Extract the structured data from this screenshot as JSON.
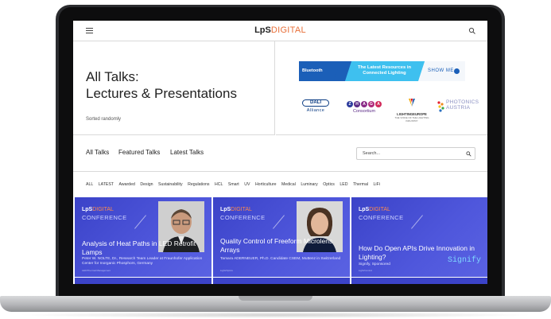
{
  "header": {
    "logo_main": "LpS",
    "logo_suffix": "DIGITAL",
    "menu_icon": "hamburger-icon",
    "search_icon": "search-icon"
  },
  "hero": {
    "title_line1": "All Talks:",
    "title_line2": "Lectures & Presentations",
    "sorted": "Sorted randomly"
  },
  "banner": {
    "brand": "Bluetooth",
    "text": "The Latest Resources in Connected Lighting",
    "cta": "SHOW ME"
  },
  "sponsors": {
    "dali_badge": "DALI",
    "dali_text": "Alliance",
    "zhaga_letters": [
      "Z",
      "H",
      "A",
      "G",
      "A"
    ],
    "zhaga_text": "Consortium",
    "lightingeurope": "LIGHTINGEUROPE",
    "lightingeurope_sub": "THE VOICE OF THE LIGHTING INDUSTRY",
    "photonics_line1": "PHOTONICS",
    "photonics_line2": "AUSTRIA"
  },
  "tabs": {
    "all": "All Talks",
    "featured": "Featured Talks",
    "latest": "Latest Talks",
    "search_placeholder": "Search..."
  },
  "categories": [
    "ALL",
    "LATEST",
    "Awarded",
    "Design",
    "Sustainability",
    "Regulations",
    "HCL",
    "Smart",
    "UV",
    "Horticulture",
    "Medical",
    "Luminary",
    "Optics",
    "LED",
    "Thermal",
    "LiFi"
  ],
  "cards": [
    {
      "conf_main": "LpS",
      "conf_suffix": "DIGITAL",
      "conf_label": "CONFERENCE",
      "title": "Analysis of Heat Paths in LED Retrofit Lamps",
      "speaker": "Peter W. NOLTE, Dr., Research Team Leader at Fraunhofer Application Center for Inorganic Phosphors, Germany",
      "tag": "LED/Thermal Management"
    },
    {
      "conf_main": "LpS",
      "conf_suffix": "DIGITAL",
      "conf_label": "CONFERENCE",
      "title": "Quality Control of Freeform Microlens Arrays",
      "speaker": "Tamara ADERNEUER, Ph.D. Candidate CSEM, Muttenz in Switzerland",
      "tag": "Light/Optics"
    },
    {
      "conf_main": "LpS",
      "conf_suffix": "DIGITAL",
      "conf_label": "CONFERENCE",
      "title": "How Do Open APIs Drive Innovation in Lighting?",
      "speaker": "Signify, Sponsored",
      "tag": "Light/Control",
      "brand": "Signify"
    }
  ],
  "colors": {
    "accent": "#e8703a",
    "card_blue": "#4249cf",
    "banner_blue": "#3ec0ef"
  }
}
